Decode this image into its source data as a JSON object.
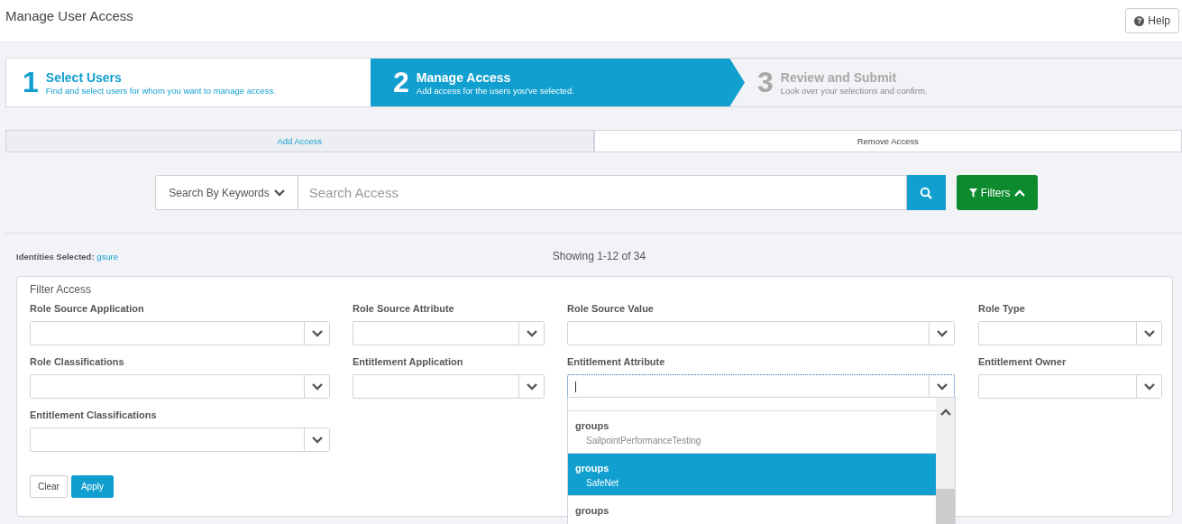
{
  "header": {
    "title": "Manage User Access",
    "help_button": {
      "icon": "?",
      "label": "Help"
    }
  },
  "wizard": [
    {
      "number": "1",
      "title": "Select Users",
      "subtitle": "Find and select users for whom you want to manage access.",
      "selected": false,
      "disabled": false
    },
    {
      "number": "2",
      "title": "Manage Access",
      "subtitle": "Add access for the users you've selected.",
      "selected": true,
      "disabled": false
    },
    {
      "number": "3",
      "title": "Review and Submit",
      "subtitle": "Look over your selections and confirm.",
      "selected": false,
      "disabled": true
    }
  ],
  "tabs": [
    {
      "label": "Add Access",
      "selected": true
    },
    {
      "label": "Remove Access",
      "selected": false
    }
  ],
  "search": {
    "mode": "Search By Keywords",
    "placeholder": "Search Access",
    "filters_button": "Filters",
    "filters_expanded": true
  },
  "identities": {
    "label": "Identities Selected:",
    "value": "gsure"
  },
  "showing": "Showing 1-12 of 34",
  "filter_panel": {
    "title": "Filter Access",
    "fields": [
      {
        "label": "Role Source Application",
        "focused": false
      },
      {
        "label": "Role Source Attribute",
        "focused": false
      },
      {
        "label": "Role Source Value",
        "focused": false
      },
      {
        "label": "Role Type",
        "focused": false
      },
      {
        "label": "Role Classifications",
        "focused": false
      },
      {
        "label": "Entitlement Application",
        "focused": false
      },
      {
        "label": "Entitlement Attribute",
        "focused": true
      },
      {
        "label": "Entitlement Owner",
        "focused": false
      },
      {
        "label": "Entitlement Classifications",
        "focused": false
      }
    ],
    "buttons": [
      {
        "label": "Clear",
        "kind": "secondary"
      },
      {
        "label": "Apply",
        "kind": "primary"
      }
    ],
    "dropdown": {
      "options": [
        {
          "title": "groups",
          "value": "SailpointPerformanceTesting",
          "selected": false
        },
        {
          "title": "groups",
          "value": "SafeNet",
          "selected": true
        },
        {
          "title": "groups",
          "selected": false
        }
      ]
    }
  }
}
